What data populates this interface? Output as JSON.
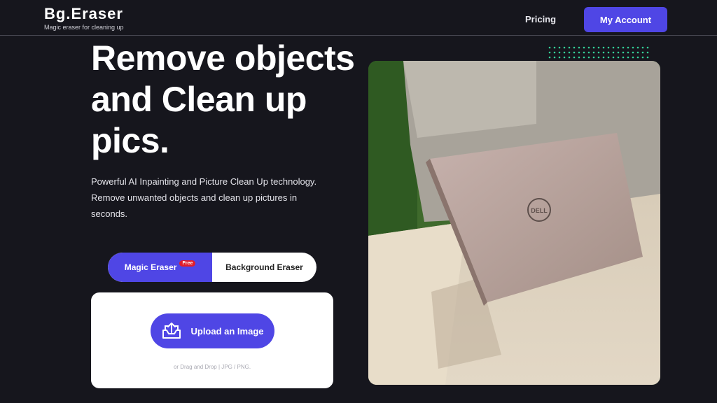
{
  "nav": {
    "brand": "Bg.Eraser",
    "tagline": "Magic eraser for cleaning up",
    "pricing": "Pricing",
    "account": "My Account"
  },
  "hero": {
    "title": "Remove objects and Clean up pics.",
    "description": "Powerful AI Inpainting and Picture Clean Up technology. Remove unwanted objects and clean up pictures in seconds."
  },
  "tabs": {
    "magic": "Magic Eraser",
    "free_badge": "Free",
    "background": "Background Eraser"
  },
  "upload": {
    "button": "Upload an Image",
    "hint": "or Drag and Drop | JPG / PNG."
  },
  "photo": {
    "logo_text": "DELL"
  },
  "colors": {
    "accent": "#4f46e5",
    "background": "#16161d",
    "badge": "#e11d2a",
    "dots": "#34d399"
  }
}
